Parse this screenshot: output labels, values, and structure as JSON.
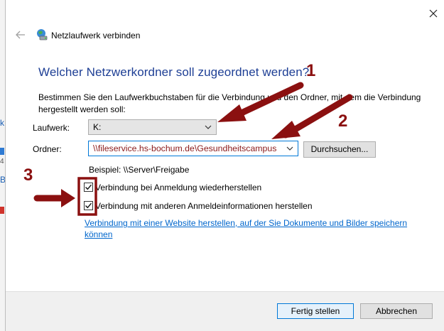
{
  "window": {
    "title": "Netzlaufwerk verbinden",
    "close_icon": "close-icon",
    "back_icon": "back-arrow-icon",
    "title_icon": "network-drive-icon"
  },
  "main": {
    "heading": "Welcher Netzwerkordner soll zugeordnet werden?",
    "instruction": "Bestimmen Sie den Laufwerkbuchstaben für die Verbindung und den Ordner, mit dem die Verbindung hergestellt werden soll:",
    "drive_label": "Laufwerk:",
    "drive_value": "K:",
    "folder_label": "Ordner:",
    "folder_value": "\\\\fileservice.hs-bochum.de\\Gesundheitscampus",
    "browse_label": "Durchsuchen...",
    "example": "Beispiel: \\\\Server\\Freigabe",
    "reconnect_label": "Verbindung bei Anmeldung wiederherstellen",
    "reconnect_checked": true,
    "other_credentials_label": "Verbindung mit anderen Anmeldeinformationen herstellen",
    "other_credentials_checked": true,
    "website_link": "Verbindung mit einer Website herstellen, auf der Sie Dokumente und Bilder speichern können"
  },
  "footer": {
    "finish_label": "Fertig stellen",
    "cancel_label": "Abbrechen"
  },
  "annotations": {
    "marker_1": "1",
    "marker_2": "2",
    "marker_3": "3",
    "arrow_color": "#8b1010"
  },
  "background_fragments": {
    "frag_a": "k",
    "frag_b": "4",
    "frag_c": "B"
  },
  "colors": {
    "heading": "#1e3f95",
    "link": "#0066cc",
    "focus_border": "#0078d7",
    "annotation": "#8b1010"
  }
}
